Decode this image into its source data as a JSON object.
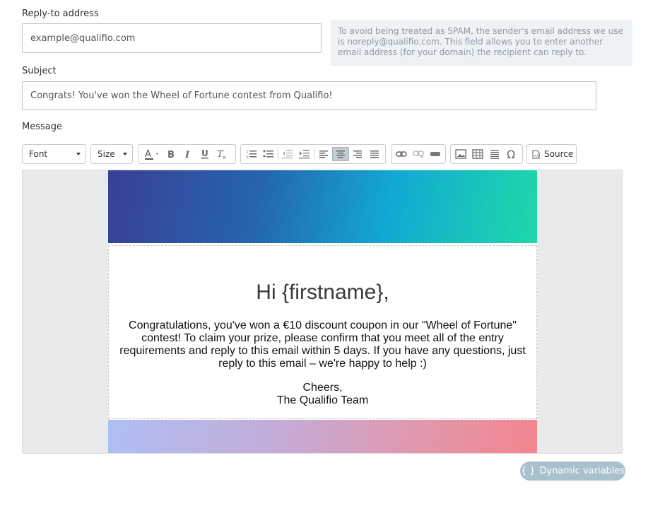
{
  "reply_to": {
    "label": "Reply-to address",
    "value": "example@qualifio.com",
    "hint": "To avoid being treated as SPAM, the sender's email address we use is noreply@qualifio.com. This field allows you to enter another email address (for your domain) the recipient can reply to."
  },
  "subject": {
    "label": "Subject",
    "value": "Congrats! You've won the Wheel of Fortune contest from Qualifio!"
  },
  "message": {
    "label": "Message",
    "toolbar": {
      "font_label": "Font",
      "size_label": "Size",
      "source_label": "Source",
      "icons": [
        "text-color-icon",
        "bold-icon",
        "italic-icon",
        "underline-icon",
        "clear-format-icon",
        "numbered-list-icon",
        "bulleted-list-icon",
        "outdent-icon",
        "indent-icon",
        "align-left-icon",
        "align-center-icon",
        "align-right-icon",
        "justify-icon",
        "link-icon",
        "unlink-icon",
        "anchor-icon",
        "image-icon",
        "table-icon",
        "horizontal-line-icon",
        "special-char-icon",
        "source-icon"
      ]
    },
    "email": {
      "greeting": "Hi {firstname},",
      "body": "Congratulations, you've won a €10 discount coupon in our \"Wheel of Fortune\" contest! To claim your prize, please confirm that you meet all of the entry requirements and reply to this email within 5 days. If you have any questions, just reply to this email – we're happy to help :)",
      "signoff_1": "Cheers,",
      "signoff_2": "The Qualifio Team"
    }
  },
  "dynamic_variables_label": "Dynamic variables",
  "colors": {
    "accent_button": "#a9c0cd",
    "hint_bg": "#eef2f5"
  }
}
